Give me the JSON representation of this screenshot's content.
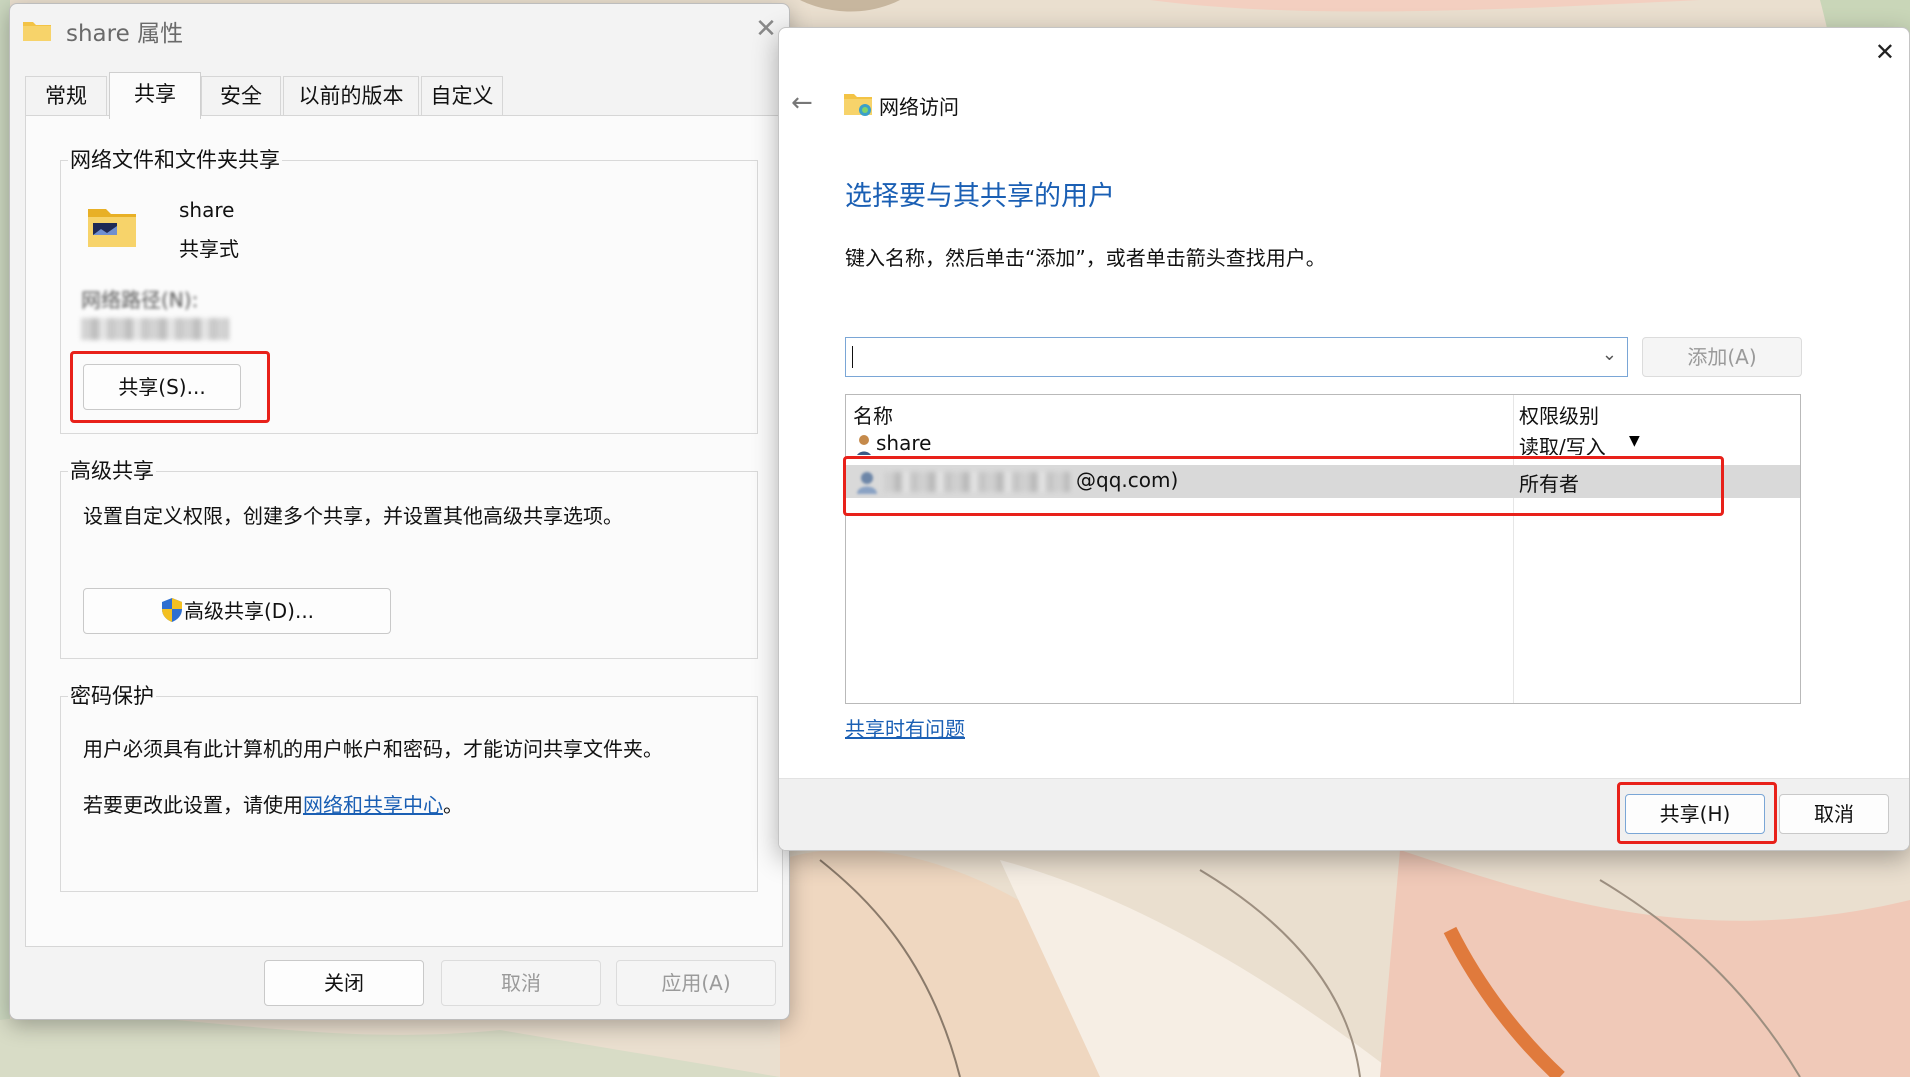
{
  "left_window": {
    "title": "share 属性",
    "tabs": [
      "常规",
      "共享",
      "安全",
      "以前的版本",
      "自定义"
    ],
    "active_tab": "共享",
    "network_sharing": {
      "group_title": "网络文件和文件夹共享",
      "folder_name": "share",
      "folder_status": "共享式",
      "network_path_label": "网络路径(N):",
      "share_button": "共享(S)..."
    },
    "advanced_sharing": {
      "group_title": "高级共享",
      "description": "设置自定义权限，创建多个共享，并设置其他高级共享选项。",
      "button": "高级共享(D)..."
    },
    "password_protection": {
      "group_title": "密码保护",
      "description": "用户必须具有此计算机的用户帐户和密码，才能访问共享文件夹。",
      "change_prefix": "若要更改此设置，请使用",
      "change_link": "网络和共享中心",
      "change_suffix": "。"
    },
    "buttons": {
      "close": "关闭",
      "cancel": "取消",
      "apply": "应用(A)"
    }
  },
  "right_window": {
    "header_title": "网络访问",
    "heading": "选择要与其共享的用户",
    "instruction": "键入名称，然后单击“添加”，或者单击箭头查找用户。",
    "input_value": "",
    "add_button": "添加(A)",
    "columns": {
      "name": "名称",
      "permission": "权限级别"
    },
    "rows": [
      {
        "name": "share",
        "permission": "读取/写入"
      },
      {
        "name_visible_suffix": "@qq.com)",
        "permission": "所有者"
      }
    ],
    "help_link": "共享时有问题",
    "share_button": "共享(H)",
    "cancel_button": "取消"
  },
  "colors": {
    "heading_blue": "#1a5fb4",
    "highlight_red": "#e8211a",
    "selected_row": "#d9d9d9"
  }
}
